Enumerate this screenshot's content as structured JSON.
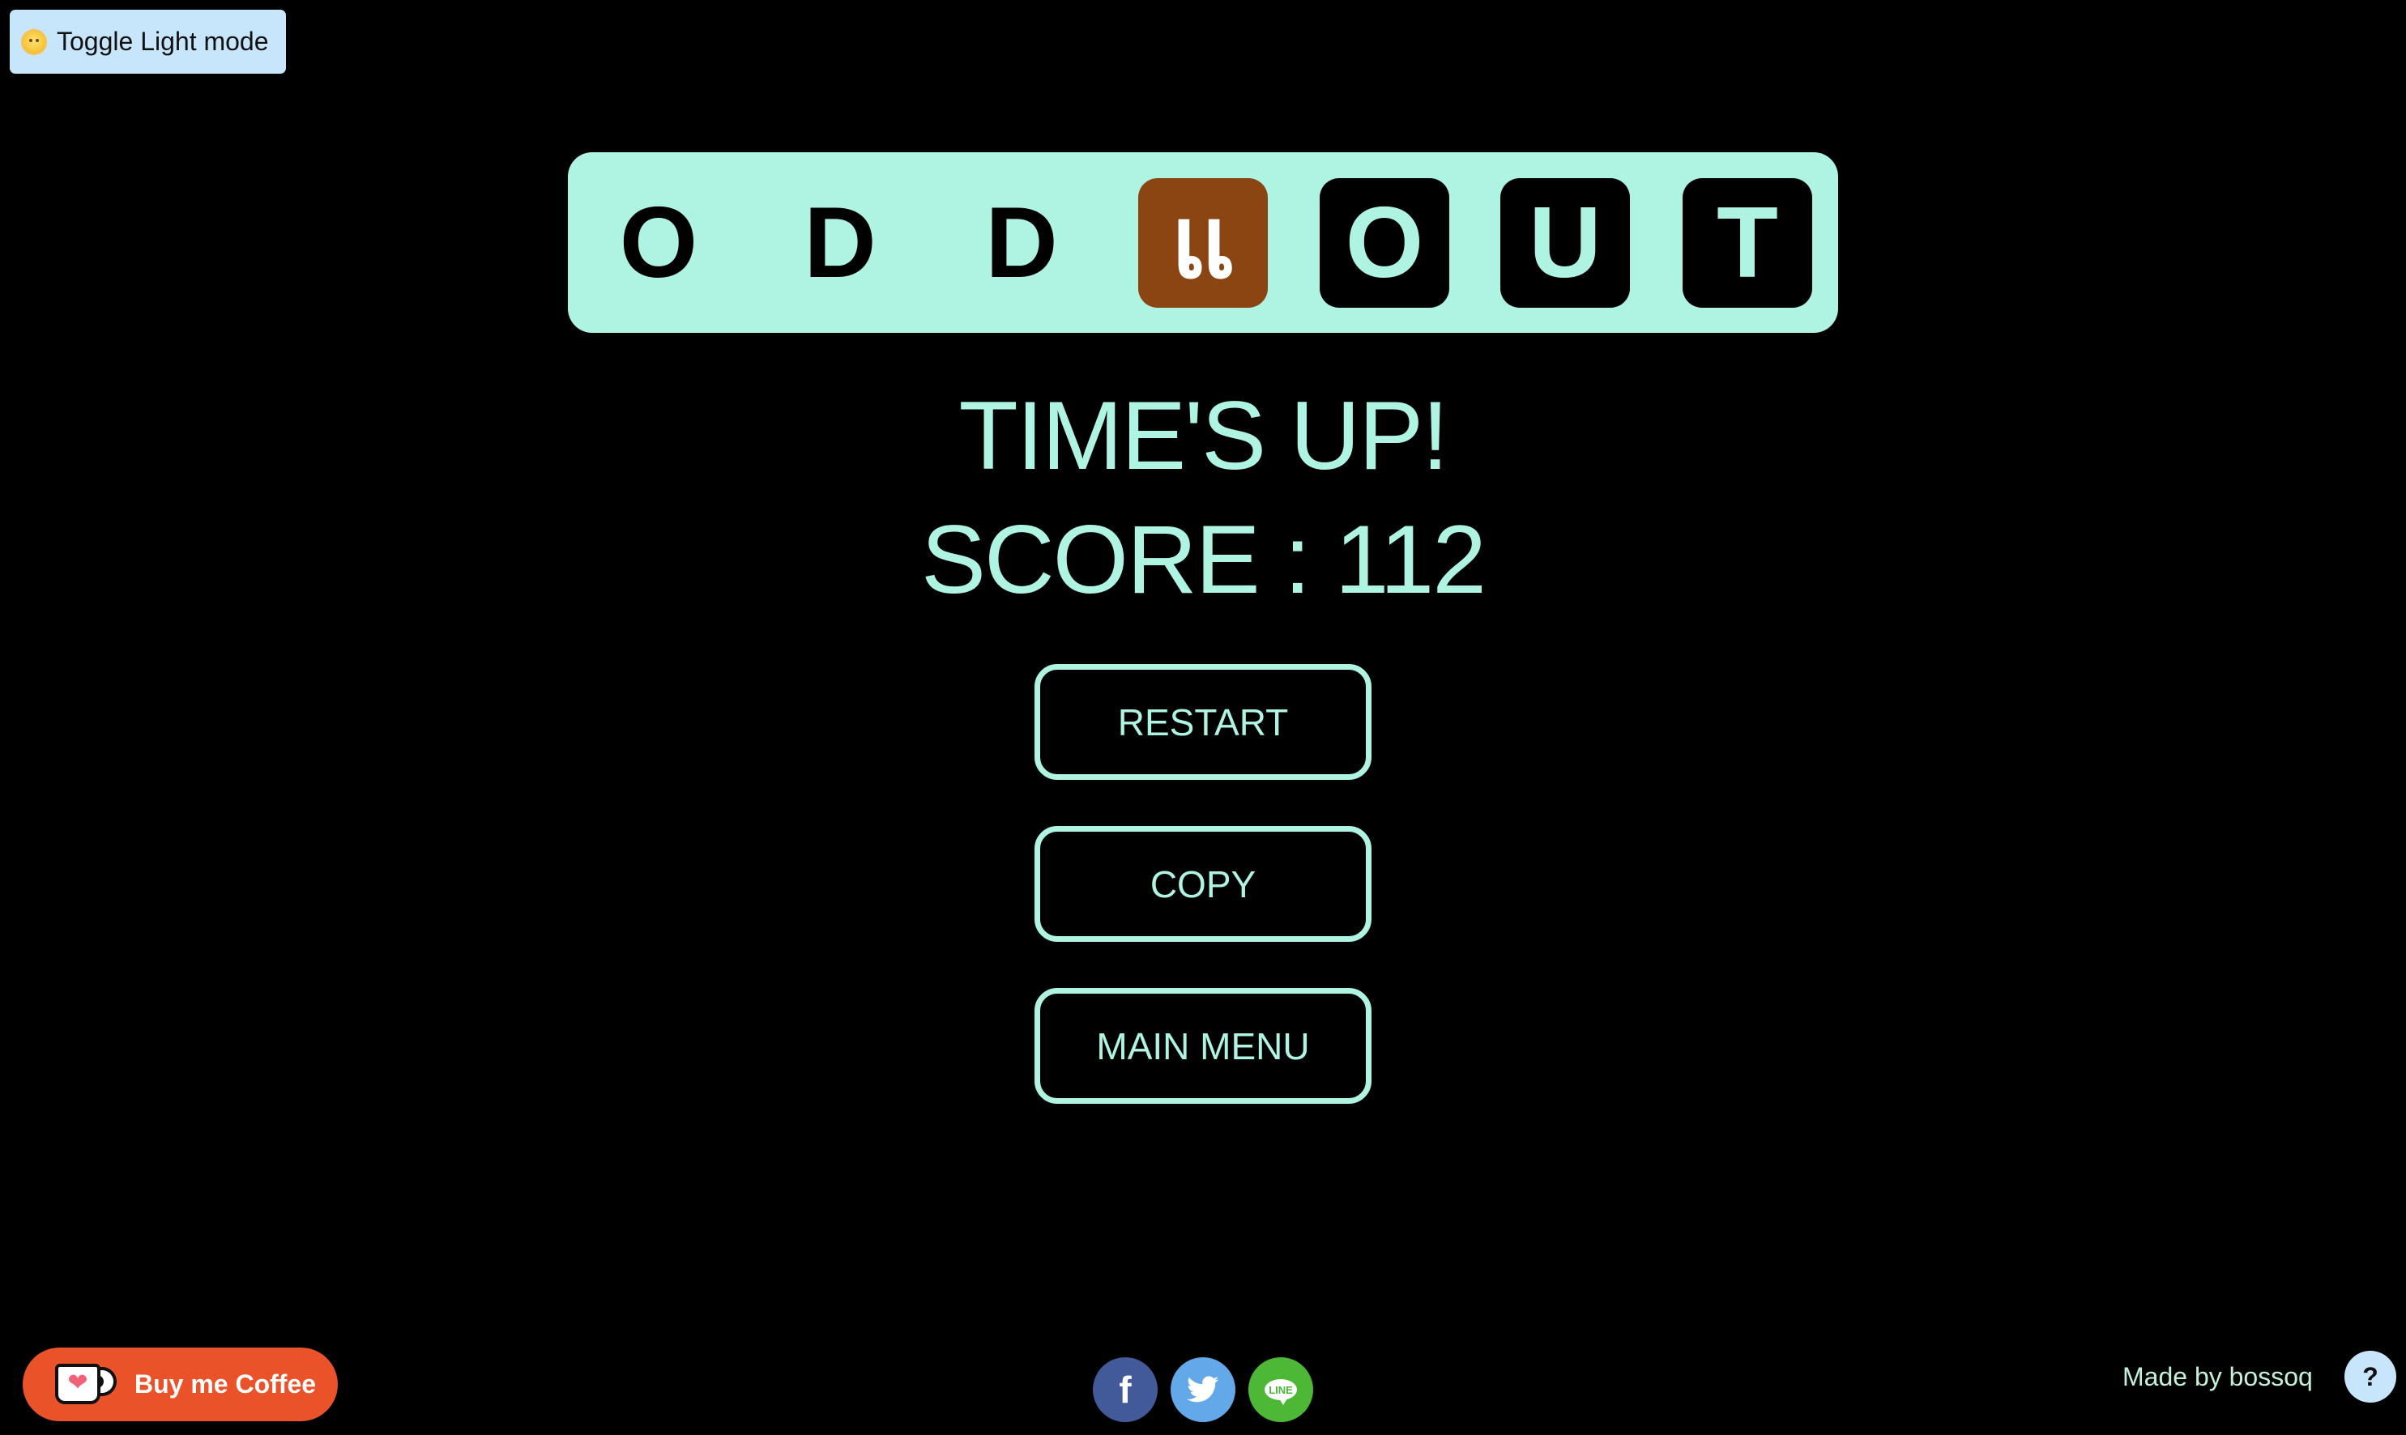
{
  "toggle": {
    "icon": "sun-face-icon",
    "label": "Toggle Light mode"
  },
  "banner": {
    "tiles": [
      {
        "letter": "O",
        "style": "plain"
      },
      {
        "letter": "D",
        "style": "plain"
      },
      {
        "letter": "D",
        "style": "plain"
      },
      {
        "letter": "แ",
        "style": "odd"
      },
      {
        "letter": "O",
        "style": "dark"
      },
      {
        "letter": "U",
        "style": "dark"
      },
      {
        "letter": "T",
        "style": "dark"
      }
    ]
  },
  "result": {
    "title": "TIME'S UP!",
    "score_label": "SCORE : 112",
    "score_value": 112
  },
  "actions": {
    "restart": "RESTART",
    "copy": "COPY",
    "main_menu": "MAIN MENU"
  },
  "footer": {
    "coffee_label": "Buy me Coffee",
    "social": [
      {
        "name": "facebook",
        "glyph": "f"
      },
      {
        "name": "twitter",
        "glyph": ""
      },
      {
        "name": "line",
        "glyph": "LINE"
      }
    ],
    "made_by": "Made by bossoq",
    "help": "?"
  },
  "colors": {
    "background": "#000000",
    "accent_mint": "#aff4e3",
    "odd_tile": "#8b4513",
    "toggle_bg": "#c8e6fb",
    "coffee": "#ea5329",
    "facebook": "#42599a",
    "twitter": "#63a8e8",
    "line": "#4cb836"
  }
}
